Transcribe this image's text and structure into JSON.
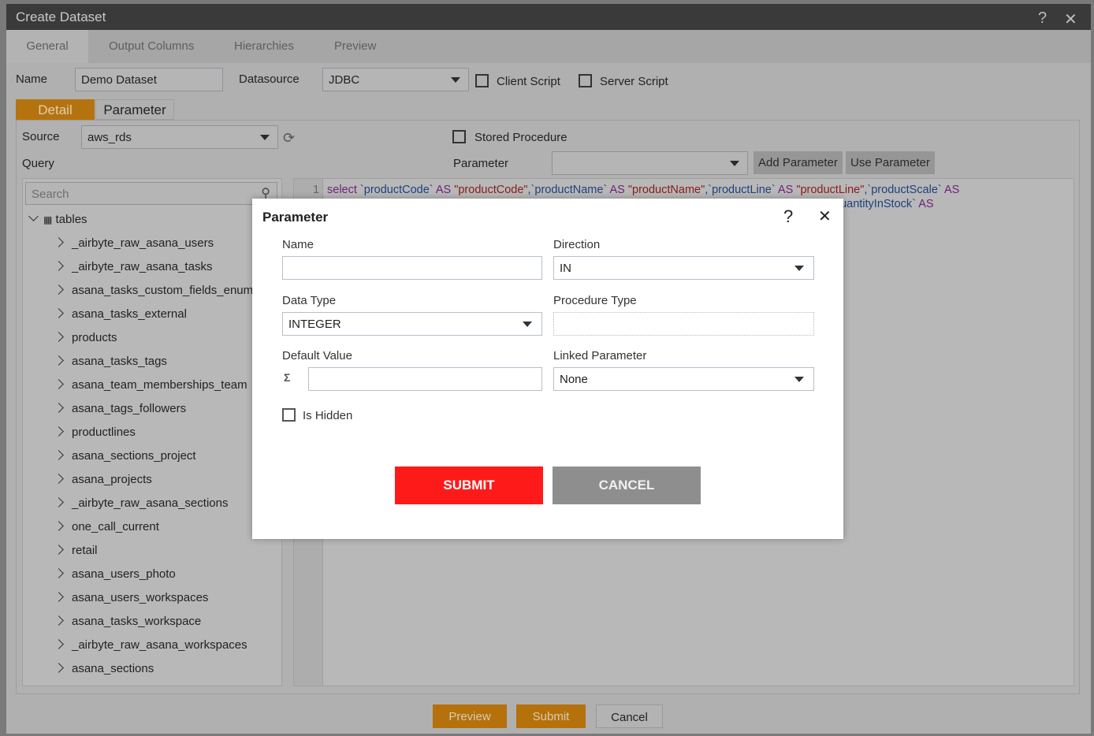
{
  "window": {
    "title": "Create Dataset",
    "help_icon": "question-icon",
    "close_icon": "close-icon"
  },
  "tabs": [
    {
      "label": "General",
      "active": true
    },
    {
      "label": "Output Columns"
    },
    {
      "label": "Hierarchies"
    },
    {
      "label": "Preview"
    }
  ],
  "form": {
    "name_label": "Name",
    "name_value": "Demo Dataset",
    "datasource_label": "Datasource",
    "datasource_value": "JDBC",
    "client_script_label": "Client Script",
    "server_script_label": "Server Script"
  },
  "subtabs": [
    {
      "label": "Detail",
      "active": true
    },
    {
      "label": "Parameter"
    }
  ],
  "detail": {
    "source_label": "Source",
    "source_value": "aws_rds",
    "query_label": "Query",
    "stored_procedure_label": "Stored Procedure",
    "parameter_label": "Parameter",
    "parameter_value": "",
    "add_parameter": "Add Parameter",
    "use_parameter": "Use Parameter",
    "search_placeholder": "Search"
  },
  "tree": {
    "root": "tables",
    "items": [
      "_airbyte_raw_asana_users",
      "_airbyte_raw_asana_tasks",
      "asana_tasks_custom_fields_enum",
      "asana_tasks_external",
      "products",
      "asana_tasks_tags",
      "asana_team_memberships_team",
      "asana_tags_followers",
      "productlines",
      "asana_sections_project",
      "asana_projects",
      "_airbyte_raw_asana_sections",
      "one_call_current",
      "retail",
      "asana_users_photo",
      "asana_users_workspaces",
      "asana_tasks_workspace",
      "_airbyte_raw_asana_workspaces",
      "asana_sections"
    ]
  },
  "editor": {
    "line_number": "1",
    "tokens": [
      [
        "kw",
        "select "
      ],
      [
        "id",
        "`productCode`"
      ],
      [
        "kw",
        " AS "
      ],
      [
        "str",
        "\"productCode\""
      ],
      [
        "id",
        ",`productName`"
      ],
      [
        "kw",
        " AS "
      ],
      [
        "str",
        "\"productName\""
      ],
      [
        "id",
        ",`productLine`"
      ],
      [
        "kw",
        " AS "
      ],
      [
        "str",
        "\"productLine\""
      ],
      [
        "id",
        ",`productScale`"
      ],
      [
        "kw",
        " AS"
      ]
    ],
    "line2_visible": "quantityInStock`",
    "line2_kw": " AS"
  },
  "footer": {
    "preview": "Preview",
    "submit": "Submit",
    "cancel": "Cancel"
  },
  "modal": {
    "title": "Parameter",
    "name_label": "Name",
    "name_value": "",
    "direction_label": "Direction",
    "direction_value": "IN",
    "data_type_label": "Data Type",
    "data_type_value": "INTEGER",
    "procedure_type_label": "Procedure Type",
    "procedure_type_value": "",
    "default_value_label": "Default Value",
    "default_value": "",
    "sigma": "Σ",
    "linked_parameter_label": "Linked Parameter",
    "linked_parameter_value": "None",
    "is_hidden_label": "Is Hidden",
    "is_hidden": false,
    "submit": "SUBMIT",
    "cancel": "CANCEL",
    "help": "?",
    "close": "✕"
  },
  "colors": {
    "accent": "#b5710c",
    "submit": "#ff1a1a",
    "cancel": "#8e8e8e",
    "titlebar": "#3a3a3a"
  }
}
